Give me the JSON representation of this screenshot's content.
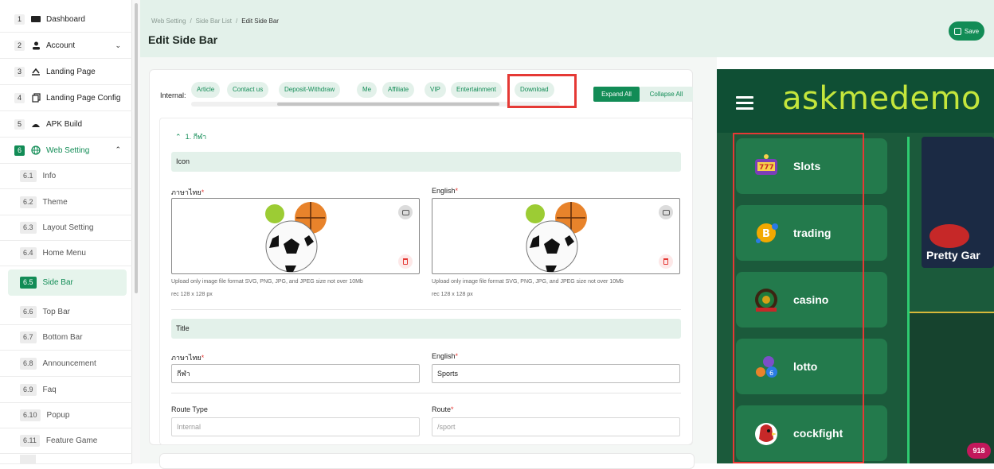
{
  "sidebar": {
    "items": [
      {
        "num": "1",
        "label": "Dashboard",
        "icon": "dashboard-icon"
      },
      {
        "num": "2",
        "label": "Account",
        "icon": "user-icon"
      },
      {
        "num": "3",
        "label": "Landing Page",
        "icon": "landing-icon"
      },
      {
        "num": "4",
        "label": "Landing Page Config",
        "icon": "copy-icon"
      },
      {
        "num": "5",
        "label": "APK Build",
        "icon": "android-icon"
      },
      {
        "num": "6",
        "label": "Web Setting",
        "icon": "globe-icon"
      }
    ],
    "subitems": [
      {
        "num": "6.1",
        "label": "Info"
      },
      {
        "num": "6.2",
        "label": "Theme"
      },
      {
        "num": "6.3",
        "label": "Layout Setting"
      },
      {
        "num": "6.4",
        "label": "Home Menu"
      },
      {
        "num": "6.5",
        "label": "Side Bar"
      },
      {
        "num": "6.6",
        "label": "Top Bar"
      },
      {
        "num": "6.7",
        "label": "Bottom Bar"
      },
      {
        "num": "6.8",
        "label": "Announcement"
      },
      {
        "num": "6.9",
        "label": "Faq"
      },
      {
        "num": "6.10",
        "label": "Popup"
      },
      {
        "num": "6.11",
        "label": "Feature Game"
      }
    ]
  },
  "header": {
    "breadcrumb": [
      "Web Setting",
      "Side Bar List",
      "Edit Side Bar"
    ],
    "title": "Edit Side Bar",
    "save_label": "Save"
  },
  "toolbar": {
    "internal_label": "Internal:",
    "chips": [
      "Article",
      "Contact us",
      "Deposit-Withdraw",
      "Me",
      "Affiliate",
      "VIP",
      "Entertainment",
      "Download"
    ],
    "expand_label": "Expand All",
    "collapse_label": "Collapse All"
  },
  "section": {
    "header": "1. กีฬา",
    "icon_band": "Icon",
    "thai_label": "ภาษาไทย",
    "english_label": "English",
    "help_text": "Upload only image file format SVG, PNG, JPG, and JPEG size not over 10Mb",
    "rec_text": "rec 128 x 128 px",
    "title_band": "Title",
    "title_thai_value": "กีฬา",
    "title_english_value": "Sports",
    "route_type_label": "Route Type",
    "route_type_placeholder": "Internal",
    "route_label": "Route",
    "route_placeholder": "/sport"
  },
  "preview": {
    "logo": "askmedemo",
    "menu": [
      "Slots",
      "trading",
      "casino",
      "lotto",
      "cockfight"
    ],
    "banner_text": "Pretty Gar",
    "badge_text": "918"
  },
  "colors": {
    "accent": "#128c56",
    "accent_light": "#e3f1ea",
    "highlight": "#e53935",
    "preview_bg": "#1b5a3b",
    "logo": "#c4e63c"
  }
}
